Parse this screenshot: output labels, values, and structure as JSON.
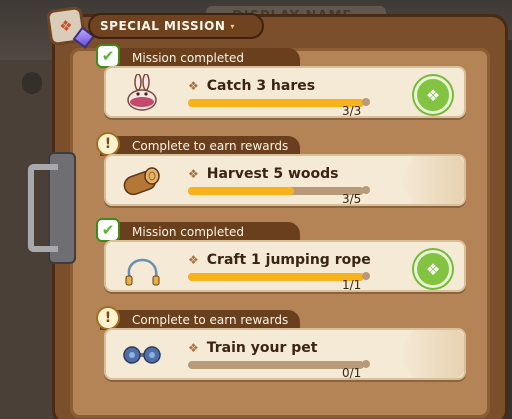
{
  "background": {
    "label": "DISPLAY NAME"
  },
  "header": {
    "title": "SPECIAL MISSION",
    "caret": "▾"
  },
  "missions": [
    {
      "status": "completed",
      "status_label": "Mission completed",
      "title": "Catch 3 hares",
      "progress_text": "3/3",
      "progress": 1.0,
      "icon": "hare-icon",
      "claimable": true
    },
    {
      "status": "in_progress",
      "status_label": "Complete to earn rewards",
      "title": "Harvest 5 woods",
      "progress_text": "3/5",
      "progress": 0.6,
      "icon": "wood-log-icon",
      "claimable": false
    },
    {
      "status": "completed",
      "status_label": "Mission completed",
      "title": "Craft 1 jumping rope",
      "progress_text": "1/1",
      "progress": 1.0,
      "icon": "jumping-rope-icon",
      "claimable": true
    },
    {
      "status": "in_progress",
      "status_label": "Complete to earn rewards",
      "title": "Train your pet",
      "progress_text": "0/1",
      "progress": 0.0,
      "icon": "dumbbell-icon",
      "claimable": false
    }
  ],
  "colors": {
    "progress_fill": "#f7b21c",
    "claim_green": "#82c341",
    "panel": "#b48457"
  }
}
